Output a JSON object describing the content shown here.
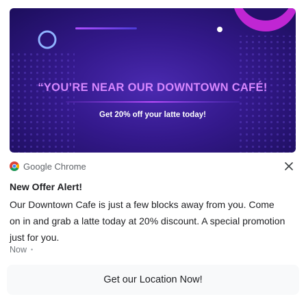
{
  "banner": {
    "headline": "“YOU’RE NEAR OUR DOWNTOWN CAFÉ!",
    "subline": "Get 20% off your latte today!"
  },
  "header": {
    "app_name": "Google Chrome",
    "app_icon": "chrome-icon",
    "close_icon": "close-icon"
  },
  "notification": {
    "title": "New Offer Alert!",
    "message": "Our Downtown Cafe is just a few blocks away from you. Come on in and grab a latte today at 20% discount. A special promotion just for you.",
    "time": "Now"
  },
  "action": {
    "label": "Get our Location Now!"
  },
  "colors": {
    "banner_bg": "#34198c",
    "headline": "#d887ff",
    "accent_magenta": "#c026d3",
    "button_bg": "#f8f9fa"
  }
}
